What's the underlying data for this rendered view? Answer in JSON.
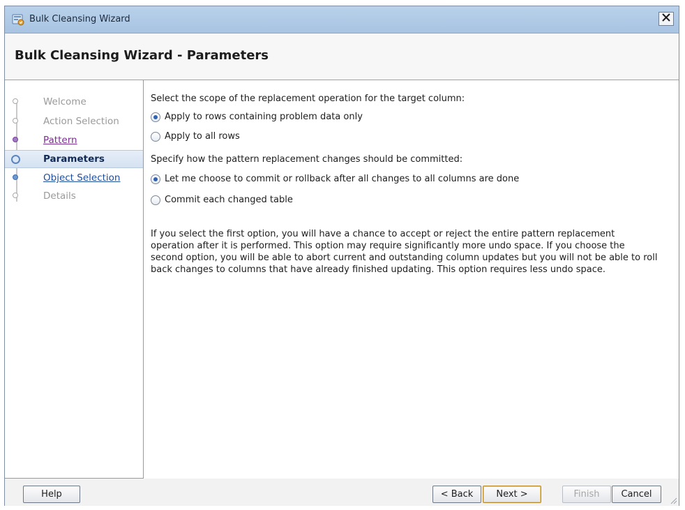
{
  "window": {
    "title": "Bulk Cleansing Wizard",
    "close_glyph": "✕"
  },
  "header": {
    "title": "Bulk Cleansing Wizard - Parameters"
  },
  "nav": {
    "items": [
      {
        "label": "Welcome",
        "state": "disabled"
      },
      {
        "label": "Action Selection",
        "state": "disabled"
      },
      {
        "label": "Pattern",
        "state": "visited"
      },
      {
        "label": "Parameters",
        "state": "current"
      },
      {
        "label": "Object Selection",
        "state": "link"
      },
      {
        "label": "Details",
        "state": "disabled"
      }
    ]
  },
  "content": {
    "scope_prompt": "Select the scope of the replacement operation for the target column:",
    "scope_options": [
      {
        "label": "Apply to rows containing problem data only",
        "checked": true
      },
      {
        "label": "Apply to all rows",
        "checked": false
      }
    ],
    "commit_prompt": "Specify how the pattern replacement changes should be committed:",
    "commit_options": [
      {
        "label": "Let me choose to commit or rollback after all changes to all columns are done",
        "checked": true
      },
      {
        "label": "Commit each changed table",
        "checked": false
      }
    ],
    "explanation": "If you select the first option, you will have a chance to accept or reject the entire pattern replacement operation after it is performed. This option may require significantly more undo space. If you choose the second option, you will be able to abort current and outstanding column updates but you will not be able to roll back changes to columns that have already finished updating. This option requires less undo space."
  },
  "footer": {
    "help": "Help",
    "back": "< Back",
    "next": "Next >",
    "finish": "Finish",
    "cancel": "Cancel"
  },
  "colors": {
    "nav_current_bg": "#dbe6f3",
    "link": "#1f4e9c",
    "visited": "#7a2f91",
    "disabled_text": "#9a9a9a",
    "titlebar": "#b3cce7"
  }
}
